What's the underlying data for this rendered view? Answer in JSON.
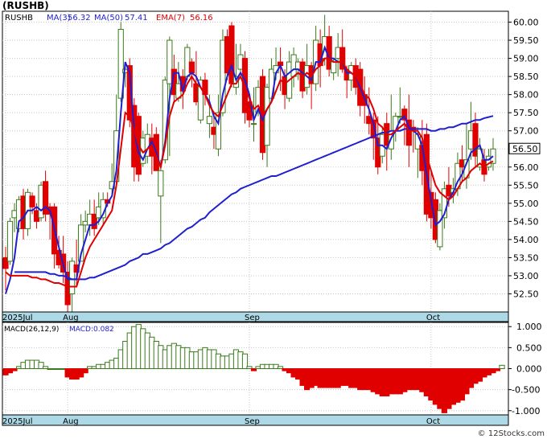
{
  "ticker_title": "(RUSHB)",
  "legend": {
    "ticker": "RUSHB",
    "ma3": {
      "label": "MA(3)",
      "value": "56.32",
      "color": "#1f1fcf"
    },
    "ma50": {
      "label": "MA(50)",
      "value": "57.41",
      "color": "#1f1fcf"
    },
    "ema7": {
      "label": "EMA(7)",
      "value": "56.16",
      "color": "#e00000"
    }
  },
  "macd_legend": {
    "label": "MACD(26,12,9)",
    "value_label": "MACD:",
    "value": "0.082"
  },
  "last_price": "56.50",
  "watermark": "© 12Stocks.com",
  "colors": {
    "up": "#3a7a1a",
    "down": "#e00000",
    "ma_line": "#1f1fcf",
    "ema_line": "#e00000",
    "axis_band": "#add8e6",
    "grid": "#c8c8c8"
  },
  "chart_data": [
    {
      "type": "candlestick",
      "title": "RUSHB",
      "x_labels": [
        {
          "index": 0,
          "text": "2025Jul"
        },
        {
          "index": 14,
          "text": "Aug"
        },
        {
          "index": 55,
          "text": "Sep"
        },
        {
          "index": 96,
          "text": "Oct"
        }
      ],
      "y_ticks": [
        52.5,
        53.0,
        53.5,
        54.0,
        54.5,
        55.0,
        55.5,
        56.0,
        56.5,
        57.0,
        57.5,
        58.0,
        58.5,
        59.0,
        59.5,
        60.0
      ],
      "ylim": [
        52.0,
        60.3
      ],
      "grid": true,
      "candles": [
        [
          53.5,
          53.2,
          52.6,
          53.8
        ],
        [
          53.4,
          54.5,
          53.3,
          54.6
        ],
        [
          54.6,
          54.8,
          54.2,
          55.0
        ],
        [
          54.3,
          55.1,
          54.2,
          55.2
        ],
        [
          55.2,
          54.3,
          54.0,
          55.4
        ],
        [
          54.3,
          55.3,
          54.1,
          55.4
        ],
        [
          55.2,
          54.9,
          54.7,
          55.3
        ],
        [
          54.8,
          54.5,
          54.3,
          55.0
        ],
        [
          54.6,
          55.5,
          54.5,
          55.6
        ],
        [
          55.6,
          54.7,
          54.5,
          55.9
        ],
        [
          54.9,
          54.7,
          54.0,
          55.0
        ],
        [
          54.9,
          53.6,
          53.2,
          55.0
        ],
        [
          53.7,
          53.3,
          53.2,
          54.1
        ],
        [
          53.6,
          53.1,
          52.8,
          54.1
        ],
        [
          53.1,
          52.2,
          51.9,
          53.4
        ],
        [
          52.5,
          53.4,
          52.0,
          53.5
        ],
        [
          53.3,
          53.1,
          52.7,
          54.0
        ],
        [
          53.4,
          54.4,
          53.4,
          54.7
        ],
        [
          54.4,
          54.5,
          54.2,
          54.8
        ],
        [
          54.4,
          54.7,
          54.1,
          55.1
        ],
        [
          54.7,
          54.3,
          54.1,
          55.1
        ],
        [
          54.6,
          54.9,
          54.4,
          55.3
        ],
        [
          54.6,
          55.1,
          54.4,
          55.3
        ],
        [
          55.1,
          55.0,
          54.9,
          55.3
        ],
        [
          55.4,
          55.6,
          55.2,
          56.1
        ],
        [
          55.6,
          57.0,
          55.6,
          58.0
        ],
        [
          57.9,
          59.8,
          57.8,
          60.0
        ],
        [
          58.6,
          58.7,
          58.2,
          58.9
        ],
        [
          58.8,
          57.3,
          57.1,
          59.0
        ],
        [
          57.7,
          56.0,
          55.6,
          57.9
        ],
        [
          57.4,
          55.8,
          55.6,
          57.5
        ],
        [
          56.1,
          56.8,
          56.0,
          57.0
        ],
        [
          56.3,
          56.9,
          56.1,
          57.2
        ],
        [
          56.8,
          56.3,
          55.8,
          57.2
        ],
        [
          56.9,
          55.9,
          55.9,
          57.1
        ],
        [
          55.2,
          55.9,
          53.9,
          56.2
        ],
        [
          56.2,
          58.4,
          56.1,
          58.5
        ],
        [
          58.3,
          59.5,
          56.3,
          59.6
        ],
        [
          58.7,
          58.0,
          57.8,
          59.1
        ],
        [
          57.9,
          58.3,
          57.8,
          58.9
        ],
        [
          58.5,
          58.1,
          57.6,
          58.7
        ],
        [
          58.5,
          59.3,
          58.4,
          59.4
        ],
        [
          58.9,
          58.6,
          58.2,
          59.0
        ],
        [
          58.3,
          57.8,
          57.7,
          59.2
        ],
        [
          57.3,
          58.4,
          57.2,
          58.5
        ],
        [
          58.4,
          58.0,
          57.7,
          58.6
        ],
        [
          57.2,
          57.4,
          56.8,
          58.0
        ],
        [
          57.1,
          56.9,
          56.5,
          57.5
        ],
        [
          56.5,
          57.5,
          56.3,
          58.0
        ],
        [
          57.5,
          59.5,
          57.4,
          59.8
        ],
        [
          59.6,
          58.6,
          58.4,
          59.8
        ],
        [
          59.9,
          58.3,
          58.2,
          60.0
        ],
        [
          58.2,
          58.5,
          58.0,
          59.4
        ],
        [
          58.7,
          59.1,
          58.6,
          59.4
        ],
        [
          59.0,
          57.5,
          57.2,
          59.2
        ],
        [
          57.8,
          57.3,
          57.1,
          58.0
        ],
        [
          57.2,
          57.2,
          56.7,
          58.2
        ],
        [
          57.5,
          58.2,
          57.4,
          58.4
        ],
        [
          58.5,
          56.4,
          56.2,
          58.7
        ],
        [
          56.6,
          58.2,
          56.0,
          58.3
        ],
        [
          57.9,
          58.7,
          57.8,
          59.0
        ],
        [
          58.6,
          58.8,
          58.4,
          59.3
        ],
        [
          58.9,
          58.8,
          58.1,
          59.3
        ],
        [
          58.5,
          58.0,
          57.6,
          58.7
        ],
        [
          57.9,
          58.9,
          57.8,
          59.2
        ],
        [
          58.5,
          59.1,
          58.2,
          59.3
        ],
        [
          58.7,
          58.9,
          58.4,
          59.0
        ],
        [
          58.9,
          58.1,
          57.9,
          59.0
        ],
        [
          58.2,
          58.8,
          58.0,
          59.4
        ],
        [
          58.8,
          58.3,
          57.6,
          58.9
        ],
        [
          58.3,
          59.5,
          58.1,
          59.9
        ],
        [
          59.4,
          58.8,
          58.2,
          59.8
        ],
        [
          59.0,
          59.6,
          58.8,
          60.2
        ],
        [
          59.6,
          58.7,
          58.5,
          59.9
        ],
        [
          58.6,
          58.9,
          58.4,
          59.0
        ],
        [
          59.0,
          59.3,
          58.5,
          59.7
        ],
        [
          59.3,
          58.7,
          58.6,
          59.8
        ],
        [
          58.7,
          58.4,
          57.9,
          58.8
        ],
        [
          58.4,
          58.8,
          58.1,
          58.9
        ],
        [
          58.8,
          58.2,
          58.0,
          59.0
        ],
        [
          58.7,
          57.7,
          57.4,
          58.9
        ],
        [
          58.0,
          57.7,
          57.2,
          58.5
        ],
        [
          57.4,
          57.2,
          56.9,
          58.2
        ],
        [
          57.3,
          56.8,
          56.2,
          57.5
        ],
        [
          56.8,
          56.0,
          55.8,
          57.4
        ],
        [
          56.3,
          56.9,
          56.1,
          57.1
        ],
        [
          57.2,
          56.6,
          55.9,
          57.5
        ],
        [
          56.5,
          57.0,
          56.2,
          58.0
        ],
        [
          57.0,
          57.4,
          56.7,
          57.5
        ],
        [
          57.4,
          57.4,
          57.2,
          58.2
        ],
        [
          57.6,
          57.3,
          56.6,
          57.7
        ],
        [
          57.3,
          56.6,
          56.0,
          58.0
        ],
        [
          57.1,
          57.0,
          56.4,
          57.3
        ],
        [
          56.5,
          56.9,
          55.7,
          57.1
        ],
        [
          56.6,
          55.9,
          55.5,
          57.3
        ],
        [
          56.9,
          54.7,
          54.5,
          57.2
        ],
        [
          55.3,
          54.6,
          54.3,
          55.9
        ],
        [
          55.1,
          54.0,
          53.9,
          55.3
        ],
        [
          53.8,
          54.8,
          53.7,
          55.0
        ],
        [
          54.6,
          55.4,
          54.3,
          55.6
        ],
        [
          55.5,
          55.2,
          54.9,
          56.0
        ],
        [
          55.3,
          55.4,
          55.0,
          55.7
        ],
        [
          55.4,
          56.1,
          55.2,
          56.4
        ],
        [
          56.2,
          56.0,
          55.6,
          56.6
        ],
        [
          55.7,
          56.2,
          55.4,
          57.2
        ],
        [
          56.5,
          57.0,
          56.2,
          57.8
        ],
        [
          57.2,
          56.3,
          56.0,
          57.5
        ],
        [
          56.0,
          56.5,
          55.9,
          56.8
        ],
        [
          56.2,
          55.8,
          55.6,
          56.5
        ],
        [
          56.0,
          56.3,
          55.9,
          56.5
        ],
        [
          56.1,
          56.5,
          55.9,
          56.8
        ]
      ],
      "series": [
        {
          "name": "MA(3)",
          "color": "#1f1fcf",
          "values": [
            52.5,
            52.9,
            53.5,
            54.5,
            54.6,
            54.8,
            54.8,
            54.9,
            54.8,
            54.9,
            54.8,
            54.3,
            53.8,
            53.3,
            52.9,
            52.9,
            52.9,
            53.6,
            54.0,
            54.4,
            54.4,
            54.5,
            54.7,
            55.0,
            55.2,
            55.9,
            57.5,
            58.9,
            58.6,
            57.0,
            56.4,
            56.2,
            56.5,
            56.7,
            56.4,
            56.0,
            56.7,
            57.9,
            58.6,
            58.6,
            58.1,
            58.5,
            58.6,
            58.5,
            58.2,
            58.0,
            57.8,
            57.4,
            57.2,
            58.0,
            58.5,
            58.8,
            58.4,
            58.6,
            58.4,
            58.0,
            57.3,
            57.6,
            57.3,
            57.6,
            57.8,
            58.6,
            58.8,
            58.5,
            58.6,
            58.7,
            58.7,
            58.6,
            58.5,
            58.4,
            58.9,
            58.9,
            59.3,
            59.0,
            59.0,
            58.9,
            58.9,
            58.6,
            58.6,
            58.5,
            58.2,
            57.9,
            57.6,
            57.2,
            56.6,
            56.6,
            56.5,
            56.8,
            57.0,
            57.3,
            57.4,
            57.1,
            57.0,
            56.9,
            56.6,
            55.8,
            55.1,
            54.4,
            54.5,
            54.7,
            55.1,
            55.3,
            55.6,
            55.8,
            56.1,
            56.4,
            56.5,
            56.6,
            56.2,
            56.2,
            56.3
          ]
        },
        {
          "name": "MA(50)",
          "color": "#1f1fcf",
          "values": [
            null,
            null,
            53.1,
            53.1,
            53.1,
            53.1,
            53.1,
            53.1,
            53.1,
            53.1,
            53.05,
            53.05,
            53.0,
            53.0,
            52.95,
            52.9,
            52.9,
            52.9,
            52.9,
            52.95,
            52.95,
            53.0,
            53.05,
            53.1,
            53.15,
            53.2,
            53.25,
            53.3,
            53.4,
            53.45,
            53.5,
            53.6,
            53.6,
            53.65,
            53.7,
            53.75,
            53.85,
            53.9,
            54.0,
            54.1,
            54.2,
            54.3,
            54.35,
            54.45,
            54.55,
            54.6,
            54.75,
            54.85,
            54.95,
            55.05,
            55.15,
            55.25,
            55.3,
            55.4,
            55.45,
            55.5,
            55.55,
            55.6,
            55.65,
            55.7,
            55.75,
            55.75,
            55.8,
            55.85,
            55.9,
            55.95,
            56.0,
            56.05,
            56.1,
            56.15,
            56.2,
            56.25,
            56.3,
            56.35,
            56.4,
            56.45,
            56.5,
            56.55,
            56.6,
            56.65,
            56.7,
            56.75,
            56.8,
            56.85,
            56.9,
            56.95,
            56.95,
            57.0,
            57.0,
            57.0,
            57.05,
            57.05,
            57.05,
            57.05,
            57.05,
            57.05,
            57.0,
            57.0,
            57.05,
            57.05,
            57.1,
            57.1,
            57.15,
            57.2,
            57.2,
            57.25,
            57.3,
            57.3,
            57.35,
            57.38,
            57.41
          ]
        },
        {
          "name": "EMA(7)",
          "color": "#e00000",
          "values": [
            53.1,
            53.0,
            53.0,
            53.0,
            53.0,
            53.0,
            52.95,
            52.95,
            52.9,
            52.9,
            52.85,
            52.8,
            52.8,
            52.75,
            52.7,
            52.7,
            52.7,
            53.1,
            53.5,
            53.8,
            54.0,
            54.2,
            54.4,
            54.6,
            54.8,
            55.5,
            56.5,
            57.5,
            57.4,
            57.0,
            56.6,
            56.4,
            56.5,
            56.6,
            56.3,
            56.0,
            56.6,
            57.4,
            57.8,
            57.9,
            58.0,
            58.3,
            58.5,
            58.3,
            58.2,
            58.0,
            57.7,
            57.5,
            57.4,
            57.7,
            58.0,
            58.3,
            58.3,
            58.5,
            58.2,
            57.9,
            57.6,
            57.7,
            57.4,
            57.6,
            57.8,
            58.1,
            58.4,
            58.3,
            58.4,
            58.5,
            58.6,
            58.5,
            58.6,
            58.5,
            58.7,
            58.8,
            59.0,
            59.0,
            58.9,
            58.9,
            58.9,
            58.7,
            58.6,
            58.5,
            58.3,
            58.0,
            57.9,
            57.6,
            57.2,
            57.1,
            56.9,
            56.9,
            57.0,
            57.1,
            57.2,
            57.0,
            57.0,
            57.0,
            56.8,
            56.3,
            55.9,
            55.5,
            55.3,
            55.2,
            55.1,
            55.2,
            55.4,
            55.6,
            55.7,
            55.9,
            56.0,
            56.1,
            56.0,
            56.1,
            56.16
          ]
        }
      ]
    },
    {
      "type": "bar",
      "title": "MACD(26,12,9)",
      "y_ticks": [
        1.0,
        0.5,
        0.0,
        -0.5,
        -1.0
      ],
      "y_tick_labels": [
        "1.000",
        "0.500",
        "0.000",
        "-0.500",
        "-1.000"
      ],
      "ylim": [
        -1.1,
        1.1
      ],
      "grid": true,
      "x_labels": [
        {
          "index": 0,
          "text": "2025Jul"
        },
        {
          "index": 14,
          "text": "Aug"
        },
        {
          "index": 55,
          "text": "Sep"
        },
        {
          "index": 96,
          "text": "Oct"
        }
      ],
      "values": [
        -0.15,
        -0.1,
        -0.05,
        0.05,
        0.15,
        0.2,
        0.2,
        0.2,
        0.15,
        0.05,
        0.0,
        0.0,
        0.0,
        0.0,
        -0.2,
        -0.25,
        -0.25,
        -0.2,
        -0.1,
        0.05,
        0.05,
        0.1,
        0.1,
        0.15,
        0.2,
        0.25,
        0.45,
        0.65,
        0.85,
        1.0,
        1.05,
        0.95,
        0.85,
        0.75,
        0.65,
        0.55,
        0.45,
        0.55,
        0.6,
        0.55,
        0.5,
        0.5,
        0.4,
        0.4,
        0.45,
        0.5,
        0.45,
        0.45,
        0.35,
        0.3,
        0.3,
        0.35,
        0.45,
        0.4,
        0.35,
        0.05,
        -0.05,
        0.05,
        0.1,
        0.1,
        0.1,
        0.1,
        0.05,
        -0.05,
        -0.1,
        -0.2,
        -0.25,
        -0.4,
        -0.5,
        -0.45,
        -0.4,
        -0.45,
        -0.45,
        -0.45,
        -0.45,
        -0.45,
        -0.4,
        -0.4,
        -0.45,
        -0.45,
        -0.5,
        -0.5,
        -0.5,
        -0.55,
        -0.6,
        -0.65,
        -0.65,
        -0.6,
        -0.6,
        -0.6,
        -0.55,
        -0.5,
        -0.5,
        -0.5,
        -0.55,
        -0.65,
        -0.75,
        -0.85,
        -0.95,
        -1.05,
        -0.95,
        -0.85,
        -0.8,
        -0.75,
        -0.6,
        -0.45,
        -0.35,
        -0.3,
        -0.2,
        -0.15,
        -0.1,
        -0.05,
        0.08
      ]
    }
  ]
}
